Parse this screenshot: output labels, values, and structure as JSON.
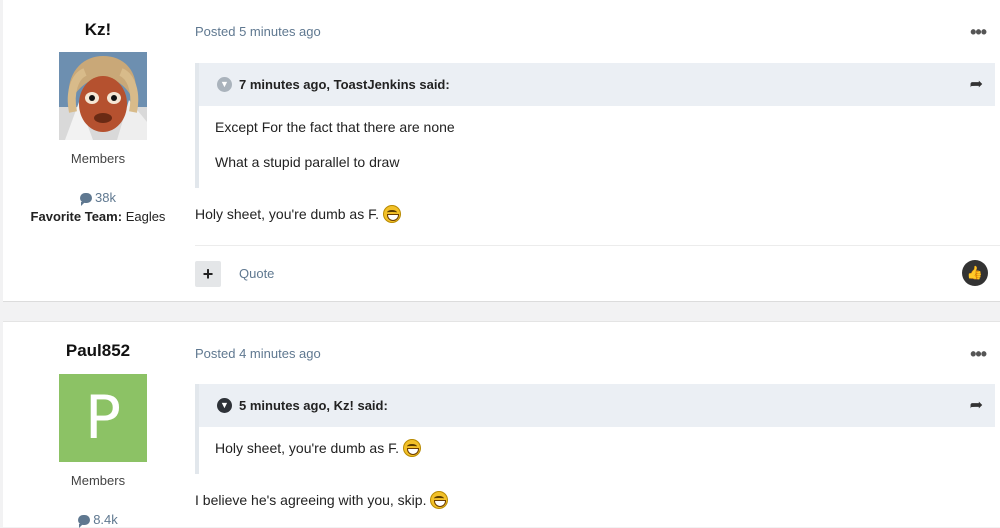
{
  "posts": [
    {
      "author": "Kz!",
      "group": "Members",
      "post_count": "38k",
      "favorite_team_label": "Favorite Team:",
      "favorite_team": "Eagles",
      "posted": "Posted 5 minutes ago",
      "quote": {
        "cite": "7 minutes ago, ToastJenkins said:",
        "lines": [
          "Except For the fact that there are none",
          "What a stupid parallel to draw"
        ]
      },
      "reply_text": "Holy sheet, you're dumb as F.",
      "quote_label": "Quote"
    },
    {
      "author": "Paul852",
      "avatar_letter": "P",
      "group": "Members",
      "post_count": "8.4k",
      "posted": "Posted 4 minutes ago",
      "quote": {
        "cite": "5 minutes ago, Kz! said:",
        "lines": [
          "Holy sheet, you're dumb as F."
        ]
      },
      "reply_text": "I believe he's agreeing with you, skip."
    }
  ],
  "icons": {
    "more": "ellipsis-icon",
    "share": "share-arrow-icon",
    "comment": "comment-bubble-icon",
    "like": "thumbs-up-icon",
    "emoji": "grin-emoji-icon"
  },
  "colors": {
    "link": "#5f7890",
    "quote_bg": "#ebeff4",
    "avatar_bg": "#8cc265"
  }
}
